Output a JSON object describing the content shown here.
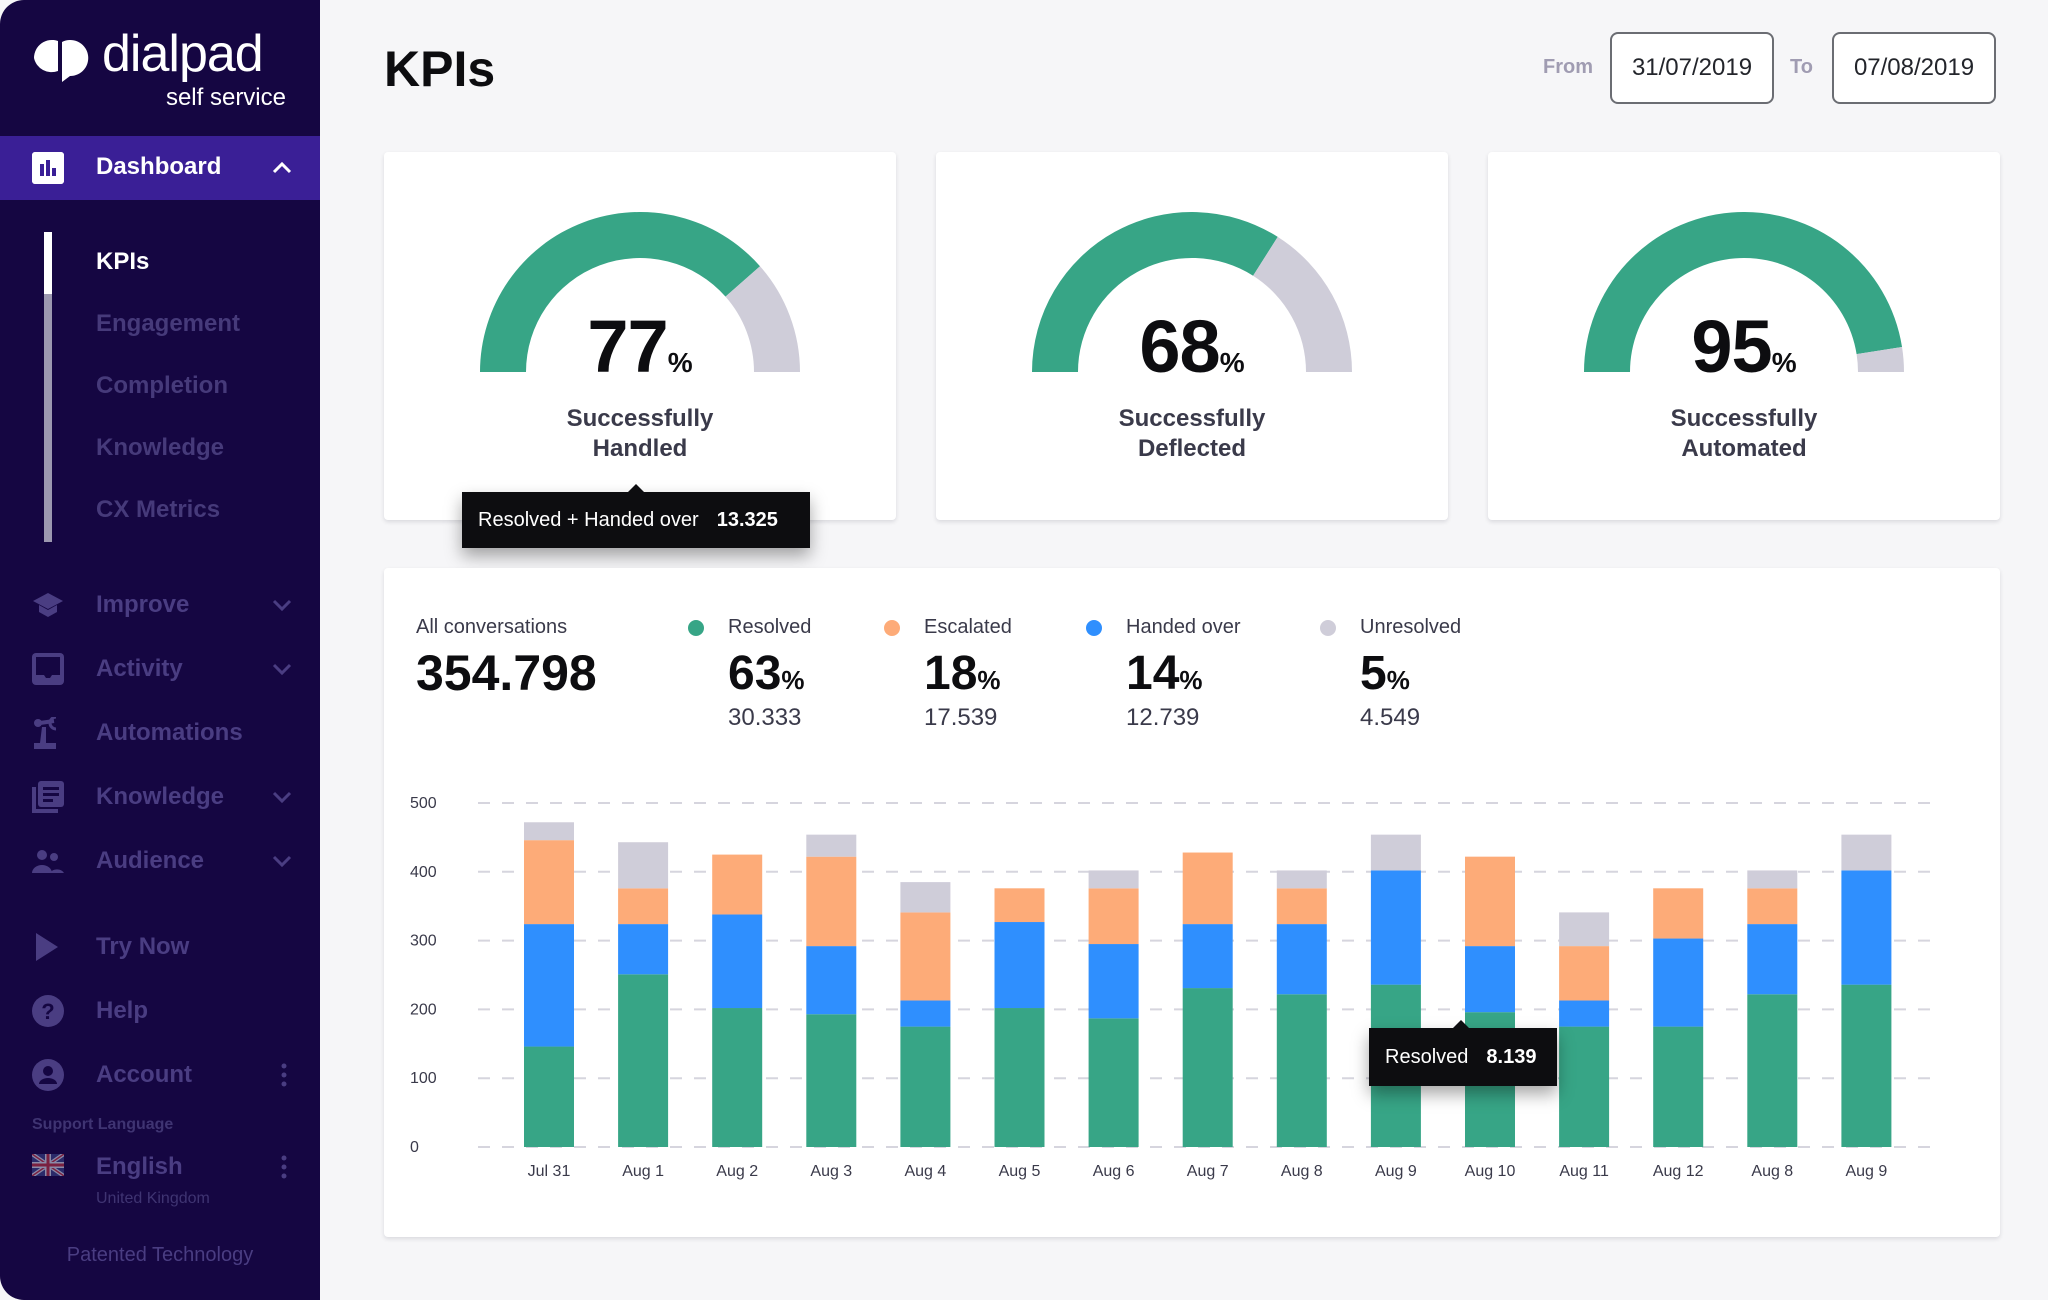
{
  "sidebar": {
    "brand": "dialpad",
    "brand_sub": "self service",
    "active_section": {
      "label": "Dashboard",
      "icon": "bar-chart-icon"
    },
    "sub_items": [
      {
        "label": "KPIs",
        "active": true
      },
      {
        "label": "Engagement",
        "active": false
      },
      {
        "label": "Completion",
        "active": false
      },
      {
        "label": "Knowledge",
        "active": false
      },
      {
        "label": "CX Metrics",
        "active": false
      }
    ],
    "items": [
      {
        "label": "Improve",
        "icon": "graduation-cap-icon",
        "expandable": true
      },
      {
        "label": "Activity",
        "icon": "inbox-icon",
        "expandable": true
      },
      {
        "label": "Automations",
        "icon": "robot-arm-icon",
        "expandable": false
      },
      {
        "label": "Knowledge",
        "icon": "library-icon",
        "expandable": true
      },
      {
        "label": "Audience",
        "icon": "people-icon",
        "expandable": true
      }
    ],
    "footer_items": [
      {
        "label": "Try Now",
        "icon": "play-icon"
      },
      {
        "label": "Help",
        "icon": "help-circle-icon"
      },
      {
        "label": "Account",
        "icon": "account-circle-icon"
      }
    ],
    "support_language_label": "Support Language",
    "language": {
      "label": "English",
      "sub": "United Kingdom",
      "icon": "uk-flag-icon"
    },
    "patented": "Patented Technology"
  },
  "header": {
    "title": "KPIs",
    "from_label": "From",
    "from_value": "31/07/2019",
    "to_label": "To",
    "to_value": "07/08/2019"
  },
  "kpis": [
    {
      "value": "77",
      "unit": "%",
      "percent": 77,
      "label_line1": "Successfully",
      "label_line2": "Handled"
    },
    {
      "value": "68",
      "unit": "%",
      "percent": 68,
      "label_line1": "Successfully",
      "label_line2": "Deflected"
    },
    {
      "value": "95",
      "unit": "%",
      "percent": 95,
      "label_line1": "Successfully",
      "label_line2": "Automated"
    }
  ],
  "kpi_tooltip": {
    "label": "Resolved + Handed over",
    "value": "13.325"
  },
  "summary": {
    "all_label": "All conversations",
    "all_value": "354.798",
    "metrics": [
      {
        "label": "Resolved",
        "pct": "63",
        "unit": "%",
        "count": "30.333",
        "color": "#37a586"
      },
      {
        "label": "Escalated",
        "pct": "18",
        "unit": "%",
        "count": "17.539",
        "color": "#fdab78"
      },
      {
        "label": "Handed over",
        "pct": "14",
        "unit": "%",
        "count": "12.739",
        "color": "#2f8ffe"
      },
      {
        "label": "Unresolved",
        "pct": "5",
        "unit": "%",
        "count": "4.549",
        "color": "#cfcdd9"
      }
    ]
  },
  "chart_tooltip": {
    "label": "Resolved",
    "value": "8.139"
  },
  "colors": {
    "resolved": "#37a586",
    "escalated": "#fdab78",
    "handed_over": "#2f8ffe",
    "unresolved": "#cfcdd9",
    "sidebar_bg": "#150642",
    "sidebar_active": "#3a1f96"
  },
  "chart_data": {
    "type": "bar",
    "stacked": true,
    "title": "",
    "xlabel": "",
    "ylabel": "",
    "ylim": [
      0,
      500
    ],
    "yticks": [
      0,
      100,
      200,
      300,
      400,
      500
    ],
    "grid": true,
    "categories": [
      "Jul 31",
      "Aug 1",
      "Aug 2",
      "Aug 3",
      "Aug 4",
      "Aug 5",
      "Aug 6",
      "Aug 7",
      "Aug 8",
      "Aug 9",
      "Aug 10",
      "Aug 11",
      "Aug 12",
      "Aug 8",
      "Aug 9"
    ],
    "series": [
      {
        "name": "Resolved",
        "color": "#37a586",
        "values": [
          146,
          251,
          202,
          193,
          175,
          202,
          187,
          231,
          222,
          236,
          196,
          175,
          175,
          222,
          236
        ]
      },
      {
        "name": "Handed over",
        "color": "#2f8ffe",
        "values": [
          178,
          73,
          136,
          99,
          38,
          125,
          108,
          93,
          102,
          166,
          96,
          38,
          128,
          102,
          166
        ]
      },
      {
        "name": "Escalated",
        "color": "#fdab78",
        "values": [
          122,
          52,
          87,
          130,
          128,
          49,
          81,
          104,
          52,
          0,
          130,
          79,
          73,
          52,
          0
        ]
      },
      {
        "name": "Unresolved",
        "color": "#cfcdd9",
        "values": [
          26,
          67,
          0,
          32,
          44,
          0,
          26,
          0,
          26,
          52,
          0,
          49,
          0,
          26,
          52
        ]
      }
    ]
  }
}
